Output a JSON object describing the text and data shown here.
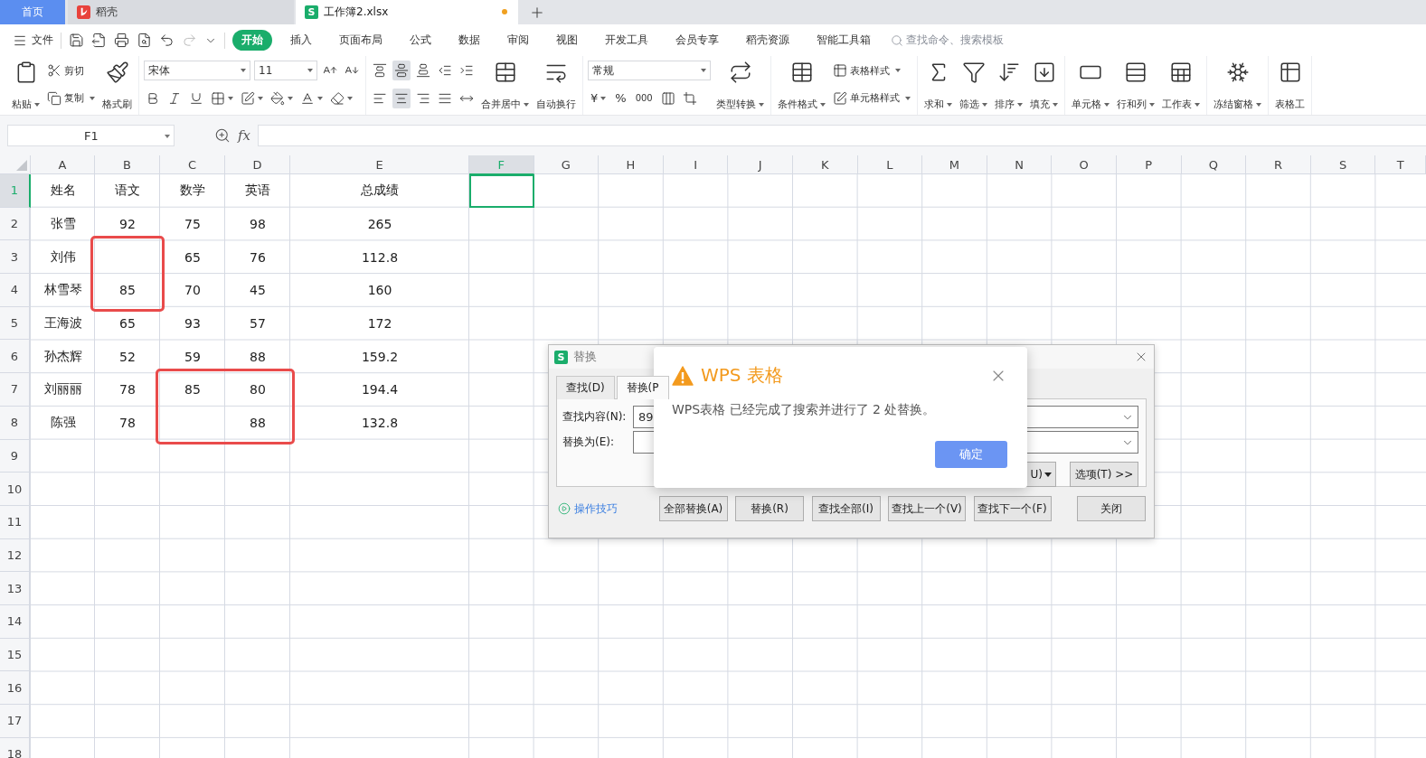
{
  "tabs": [
    {
      "label": "首页",
      "kind": "home",
      "selected": false
    },
    {
      "label": "稻壳",
      "kind": "daoke",
      "selected": false
    },
    {
      "label": "工作簿2.xlsx",
      "kind": "workbook",
      "selected": true,
      "badge": "S",
      "modified": true
    }
  ],
  "menu": {
    "file": "文件",
    "tabs": [
      {
        "label": "开始",
        "selected": true
      },
      {
        "label": "插入",
        "selected": false
      },
      {
        "label": "页面布局",
        "selected": false
      },
      {
        "label": "公式",
        "selected": false
      },
      {
        "label": "数据",
        "selected": false
      },
      {
        "label": "审阅",
        "selected": false
      },
      {
        "label": "视图",
        "selected": false
      },
      {
        "label": "开发工具",
        "selected": false
      },
      {
        "label": "会员专享",
        "selected": false
      },
      {
        "label": "稻壳资源",
        "selected": false
      },
      {
        "label": "智能工具箱",
        "selected": false
      }
    ],
    "search_placeholder": "查找命令、搜索模板"
  },
  "ribbon": {
    "groups": [
      {
        "kind": "clipboard",
        "paste": {
          "label": "粘贴",
          "dropdown": true
        },
        "cut": {
          "label": "剪切",
          "dropdown": false
        },
        "copy": {
          "label": "复制",
          "dropdown": true
        },
        "painter": {
          "label": "格式刷",
          "dropdown": false
        }
      },
      {
        "kind": "font",
        "font_name": "宋体",
        "font_size": "11"
      },
      {
        "kind": "alignment",
        "vertical_align": [
          {
            "selected": false
          },
          {
            "selected": true
          },
          {
            "selected": false
          }
        ],
        "horizontal_align": [
          {
            "selected": false
          },
          {
            "selected": true
          },
          {
            "selected": false
          },
          {
            "selected": false
          },
          {
            "selected": false
          }
        ],
        "merge": {
          "label": "合并居中",
          "dropdown": true
        },
        "wrap": {
          "label": "自动换行",
          "dropdown": false
        }
      },
      {
        "kind": "number",
        "format": "常规",
        "currency": "¥",
        "percent": "%",
        "thousands": "000",
        "convert": {
          "label": "类型转换",
          "dropdown": true
        }
      },
      {
        "kind": "styles",
        "conditional": {
          "label": "条件格式",
          "dropdown": true
        },
        "table_style": {
          "label": "表格样式",
          "dropdown": true
        },
        "cell_style": {
          "label": "单元格样式",
          "dropdown": true
        }
      },
      {
        "kind": "buttons",
        "items": [
          {
            "label": "求和",
            "dropdown": true
          },
          {
            "label": "筛选",
            "dropdown": true
          },
          {
            "label": "排序",
            "dropdown": true
          },
          {
            "label": "填充",
            "dropdown": true
          }
        ]
      },
      {
        "kind": "buttons",
        "items": [
          {
            "label": "单元格",
            "dropdown": true
          },
          {
            "label": "行和列",
            "dropdown": true
          },
          {
            "label": "工作表",
            "dropdown": true
          }
        ]
      },
      {
        "kind": "buttons",
        "items": [
          {
            "label": "冻结窗格",
            "dropdown": true
          }
        ]
      },
      {
        "kind": "buttons",
        "items": [
          {
            "label": "表格工",
            "dropdown": false
          }
        ]
      }
    ]
  },
  "formula_bar": {
    "name_box": "F1",
    "fx": "fx"
  },
  "sheet": {
    "columns": [
      {
        "label": "A",
        "selected": false
      },
      {
        "label": "B",
        "selected": false
      },
      {
        "label": "C",
        "selected": false
      },
      {
        "label": "D",
        "selected": false
      },
      {
        "label": "E",
        "selected": false
      },
      {
        "label": "F",
        "selected": true
      },
      {
        "label": "G",
        "selected": false
      },
      {
        "label": "H",
        "selected": false
      },
      {
        "label": "I",
        "selected": false
      },
      {
        "label": "J",
        "selected": false
      },
      {
        "label": "K",
        "selected": false
      },
      {
        "label": "L",
        "selected": false
      },
      {
        "label": "M",
        "selected": false
      },
      {
        "label": "N",
        "selected": false
      },
      {
        "label": "O",
        "selected": false
      },
      {
        "label": "P",
        "selected": false
      },
      {
        "label": "Q",
        "selected": false
      },
      {
        "label": "R",
        "selected": false
      },
      {
        "label": "S",
        "selected": false
      },
      {
        "label": "T",
        "selected": false
      }
    ],
    "rows": [
      {
        "label": "1",
        "selected": true,
        "cells": [
          "姓名",
          "语文",
          "数学",
          "英语",
          "总成绩"
        ]
      },
      {
        "label": "2",
        "selected": false,
        "cells": [
          "张雪",
          "92",
          "75",
          "98",
          "265"
        ]
      },
      {
        "label": "3",
        "selected": false,
        "cells": [
          "刘伟",
          null,
          "65",
          "76",
          "112.8"
        ]
      },
      {
        "label": "4",
        "selected": false,
        "cells": [
          "林雪琴",
          "85",
          "70",
          "45",
          "160"
        ]
      },
      {
        "label": "5",
        "selected": false,
        "cells": [
          "王海波",
          "65",
          "93",
          "57",
          "172"
        ]
      },
      {
        "label": "6",
        "selected": false,
        "cells": [
          "孙杰辉",
          "52",
          "59",
          "88",
          "159.2"
        ]
      },
      {
        "label": "7",
        "selected": false,
        "cells": [
          "刘丽丽",
          "78",
          "85",
          "80",
          "194.4"
        ]
      },
      {
        "label": "8",
        "selected": false,
        "cells": [
          "陈强",
          "78",
          null,
          "88",
          "132.8"
        ]
      },
      {
        "label": "9",
        "selected": false
      },
      {
        "label": "10",
        "selected": false
      },
      {
        "label": "11",
        "selected": false
      },
      {
        "label": "12",
        "selected": false
      },
      {
        "label": "13",
        "selected": false
      },
      {
        "label": "14",
        "selected": false
      },
      {
        "label": "15",
        "selected": false
      },
      {
        "label": "16",
        "selected": false
      },
      {
        "label": "17",
        "selected": false
      },
      {
        "label": "18",
        "selected": false
      }
    ],
    "annotations": [
      {
        "kind": "box"
      },
      {
        "kind": "box"
      }
    ]
  },
  "replace_dialog": {
    "badge": "S",
    "title": "替换",
    "tabs": [
      {
        "label": "查找(D)",
        "selected": false
      },
      {
        "label": "替换(P",
        "selected": true
      }
    ],
    "find_label": "查找内容(N):",
    "find_value": "89",
    "replace_label": "替换为(E):",
    "partial_button": "U)",
    "options_button": "选项(T) >>",
    "tips_link": "操作技巧",
    "buttons": [
      "全部替换(A)",
      "替换(R)",
      "查找全部(I)",
      "查找上一个(V)",
      "查找下一个(F)"
    ],
    "close_button": "关闭"
  },
  "alert": {
    "title": "WPS 表格",
    "message": "WPS表格 已经完成了搜索并进行了 2 处替换。",
    "ok": "确定"
  }
}
